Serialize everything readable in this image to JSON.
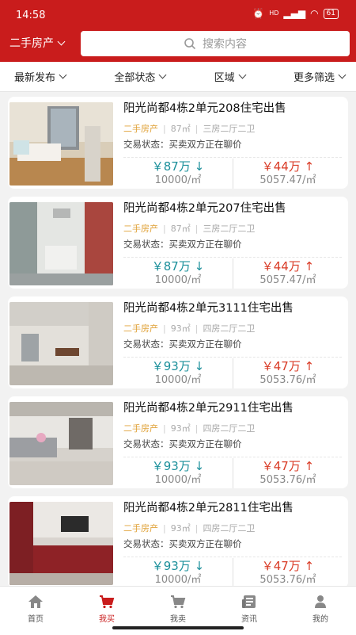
{
  "status": {
    "time": "14:58",
    "net": "HD",
    "battery": "61"
  },
  "header": {
    "city_label": "二手房产",
    "search_placeholder": "搜索内容"
  },
  "filters": [
    {
      "label": "最新发布"
    },
    {
      "label": "全部状态"
    },
    {
      "label": "区域"
    },
    {
      "label": "更多筛选"
    }
  ],
  "listings": [
    {
      "title": "阳光尚都4栋2单元208住宅出售",
      "type": "二手房产",
      "area": "87㎡",
      "layout": "三房二厅二卫",
      "trade_status": "交易状态：买卖双方正在聊价",
      "price_low": "￥87万",
      "unit_low": "10000/㎡",
      "price_high": "￥44万",
      "unit_high": "5057.47/㎡",
      "arrow_down": "↓",
      "arrow_up": "↑"
    },
    {
      "title": "阳光尚都4栋2单元207住宅出售",
      "type": "二手房产",
      "area": "87㎡",
      "layout": "三房二厅二卫",
      "trade_status": "交易状态：买卖双方正在聊价",
      "price_low": "￥87万",
      "unit_low": "10000/㎡",
      "price_high": "￥44万",
      "unit_high": "5057.47/㎡",
      "arrow_down": "↓",
      "arrow_up": "↑"
    },
    {
      "title": "阳光尚都4栋2单元3111住宅出售",
      "type": "二手房产",
      "area": "93㎡",
      "layout": "四房二厅二卫",
      "trade_status": "交易状态：买卖双方正在聊价",
      "price_low": "￥93万",
      "unit_low": "10000/㎡",
      "price_high": "￥47万",
      "unit_high": "5053.76/㎡",
      "arrow_down": "↓",
      "arrow_up": "↑"
    },
    {
      "title": "阳光尚都4栋2单元2911住宅出售",
      "type": "二手房产",
      "area": "93㎡",
      "layout": "四房二厅二卫",
      "trade_status": "交易状态：买卖双方正在聊价",
      "price_low": "￥93万",
      "unit_low": "10000/㎡",
      "price_high": "￥47万",
      "unit_high": "5053.76/㎡",
      "arrow_down": "↓",
      "arrow_up": "↑"
    },
    {
      "title": "阳光尚都4栋2单元2811住宅出售",
      "type": "二手房产",
      "area": "93㎡",
      "layout": "四房二厅二卫",
      "trade_status": "交易状态：买卖双方正在聊价",
      "price_low": "￥93万",
      "unit_low": "10000/㎡",
      "price_high": "￥47万",
      "unit_high": "5053.76/㎡",
      "arrow_down": "↓",
      "arrow_up": "↑"
    }
  ],
  "tabbar": [
    {
      "label": "首页",
      "icon": "home-icon"
    },
    {
      "label": "我买",
      "icon": "cart-icon"
    },
    {
      "label": "我卖",
      "icon": "shopping-cart-icon"
    },
    {
      "label": "资讯",
      "icon": "news-icon"
    },
    {
      "label": "我的",
      "icon": "person-icon"
    }
  ],
  "colors": {
    "brand": "#c91c1c",
    "price_down": "#1a8f9a",
    "price_up": "#d93b26",
    "tag": "#e0a33b"
  }
}
